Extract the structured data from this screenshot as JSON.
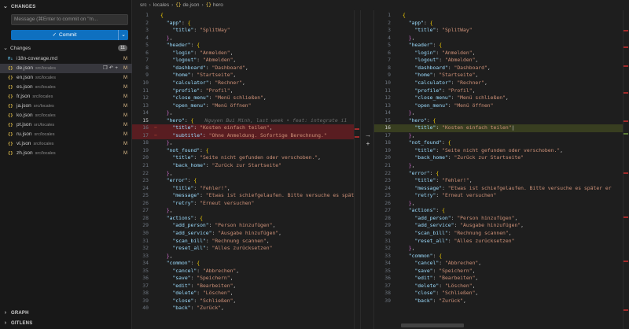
{
  "sidebar": {
    "changes_section": "CHANGES",
    "message_placeholder": "Message (⌘Enter to commit on \"m...",
    "commit_label": "Commit",
    "changes_group": "Changes",
    "changes_count": "11",
    "files": [
      {
        "icon": "md-file-icon",
        "icon_text": "M↓",
        "name": "i18n-coverage.md",
        "path": "",
        "status": "M"
      },
      {
        "icon": "json-file-icon",
        "icon_text": "{}",
        "name": "de.json",
        "path": "src/locales",
        "status": "M",
        "selected": true
      },
      {
        "icon": "json-file-icon",
        "icon_text": "{}",
        "name": "en.json",
        "path": "src/locales",
        "status": "M"
      },
      {
        "icon": "json-file-icon",
        "icon_text": "{}",
        "name": "es.json",
        "path": "src/locales",
        "status": "M"
      },
      {
        "icon": "json-file-icon",
        "icon_text": "{}",
        "name": "fr.json",
        "path": "src/locales",
        "status": "M"
      },
      {
        "icon": "json-file-icon",
        "icon_text": "{}",
        "name": "ja.json",
        "path": "src/locales",
        "status": "M"
      },
      {
        "icon": "json-file-icon",
        "icon_text": "{}",
        "name": "ko.json",
        "path": "src/locales",
        "status": "M"
      },
      {
        "icon": "json-file-icon",
        "icon_text": "{}",
        "name": "pt.json",
        "path": "src/locales",
        "status": "M"
      },
      {
        "icon": "json-file-icon",
        "icon_text": "{}",
        "name": "ru.json",
        "path": "src/locales",
        "status": "M"
      },
      {
        "icon": "json-file-icon",
        "icon_text": "{}",
        "name": "vi.json",
        "path": "src/locales",
        "status": "M"
      },
      {
        "icon": "json-file-icon",
        "icon_text": "{}",
        "name": "zh.json",
        "path": "src/locales",
        "status": "M"
      }
    ],
    "graph_section": "GRAPH",
    "gitlens_section": "GITLENS"
  },
  "breadcrumb": {
    "parts": [
      "src",
      "locales"
    ],
    "file": "de.json",
    "symbol": "hero"
  },
  "blame_text": "Nguyen Bui Minh, last week • feat: integrate i1",
  "left_lines": [
    {
      "n": "1",
      "t": "{"
    },
    {
      "n": "2",
      "t": "  \"app\": {"
    },
    {
      "n": "3",
      "t": "    \"title\": \"SplitWay\""
    },
    {
      "n": "4",
      "t": "  },"
    },
    {
      "n": "5",
      "t": "  \"header\": {"
    },
    {
      "n": "6",
      "t": "    \"login\": \"Anmelden\","
    },
    {
      "n": "7",
      "t": "    \"logout\": \"Abmelden\","
    },
    {
      "n": "8",
      "t": "    \"dashboard\": \"Dashboard\","
    },
    {
      "n": "9",
      "t": "    \"home\": \"Startseite\","
    },
    {
      "n": "10",
      "t": "    \"calculator\": \"Rechner\","
    },
    {
      "n": "11",
      "t": "    \"profile\": \"Profil\","
    },
    {
      "n": "12",
      "t": "    \"close_menu\": \"Menü schließen\","
    },
    {
      "n": "13",
      "t": "    \"open_menu\": \"Menü öffnen\""
    },
    {
      "n": "14",
      "t": "  },"
    },
    {
      "n": "15",
      "t": "  \"hero\": {"
    },
    {
      "n": "16",
      "t": "    \"title\": \"Kosten einfach teilen\","
    },
    {
      "n": "17",
      "t": "    \"subtitle\": \"Ohne Anmeldung. Sofortige Berechnung.\""
    },
    {
      "n": "18",
      "t": "  },"
    },
    {
      "n": "19",
      "t": "  \"not_found\": {"
    },
    {
      "n": "20",
      "t": "    \"title\": \"Seite nicht gefunden oder verschoben.\","
    },
    {
      "n": "21",
      "t": "    \"back_home\": \"Zurück zur Startseite\""
    },
    {
      "n": "22",
      "t": "  },"
    },
    {
      "n": "23",
      "t": "  \"error\": {"
    },
    {
      "n": "24",
      "t": "    \"title\": \"Fehler!\","
    },
    {
      "n": "25",
      "t": "    \"message\": \"Etwas ist schiefgelaufen. Bitte versuche es späte"
    },
    {
      "n": "26",
      "t": "    \"retry\": \"Erneut versuchen\""
    },
    {
      "n": "27",
      "t": "  },"
    },
    {
      "n": "28",
      "t": "  \"actions\": {"
    },
    {
      "n": "29",
      "t": "    \"add_person\": \"Person hinzufügen\","
    },
    {
      "n": "30",
      "t": "    \"add_service\": \"Ausgabe hinzufügen\","
    },
    {
      "n": "31",
      "t": "    \"scan_bill\": \"Rechnung scannen\","
    },
    {
      "n": "32",
      "t": "    \"reset_all\": \"Alles zurücksetzen\""
    },
    {
      "n": "33",
      "t": "  },"
    },
    {
      "n": "34",
      "t": "  \"common\": {"
    },
    {
      "n": "35",
      "t": "    \"cancel\": \"Abbrechen\","
    },
    {
      "n": "36",
      "t": "    \"save\": \"Speichern\","
    },
    {
      "n": "37",
      "t": "    \"edit\": \"Bearbeiten\","
    },
    {
      "n": "38",
      "t": "    \"delete\": \"Löschen\","
    },
    {
      "n": "39",
      "t": "    \"close\": \"Schließen\","
    },
    {
      "n": "40",
      "t": "    \"back\": \"Zurück\","
    }
  ],
  "right_lines": [
    {
      "n": "1",
      "t": "{"
    },
    {
      "n": "2",
      "t": "  \"app\": {"
    },
    {
      "n": "3",
      "t": "    \"title\": \"SplitWay\""
    },
    {
      "n": "4",
      "t": "  },"
    },
    {
      "n": "5",
      "t": "  \"header\": {"
    },
    {
      "n": "6",
      "t": "    \"login\": \"Anmelden\","
    },
    {
      "n": "7",
      "t": "    \"logout\": \"Abmelden\","
    },
    {
      "n": "8",
      "t": "    \"dashboard\": \"Dashboard\","
    },
    {
      "n": "9",
      "t": "    \"home\": \"Startseite\","
    },
    {
      "n": "10",
      "t": "    \"calculator\": \"Rechner\","
    },
    {
      "n": "11",
      "t": "    \"profile\": \"Profil\","
    },
    {
      "n": "12",
      "t": "    \"close_menu\": \"Menü schließen\","
    },
    {
      "n": "13",
      "t": "    \"open_menu\": \"Menü öffnen\""
    },
    {
      "n": "14",
      "t": "  },"
    },
    {
      "n": "15",
      "t": "  \"hero\": {"
    },
    {
      "n": "16",
      "t": "    \"title\": \"Kosten einfach teilen\""
    },
    {
      "n": "17",
      "t": "  },"
    },
    {
      "n": "18",
      "t": "  \"not_found\": {"
    },
    {
      "n": "19",
      "t": "    \"title\": \"Seite nicht gefunden oder verschoben.\","
    },
    {
      "n": "20",
      "t": "    \"back_home\": \"Zurück zur Startseite\""
    },
    {
      "n": "21",
      "t": "  },"
    },
    {
      "n": "22",
      "t": "  \"error\": {"
    },
    {
      "n": "23",
      "t": "    \"title\": \"Fehler!\","
    },
    {
      "n": "24",
      "t": "    \"message\": \"Etwas ist schiefgelaufen. Bitte versuche es später er"
    },
    {
      "n": "25",
      "t": "    \"retry\": \"Erneut versuchen\""
    },
    {
      "n": "26",
      "t": "  },"
    },
    {
      "n": "27",
      "t": "  \"actions\": {"
    },
    {
      "n": "28",
      "t": "    \"add_person\": \"Person hinzufügen\","
    },
    {
      "n": "29",
      "t": "    \"add_service\": \"Ausgabe hinzufügen\","
    },
    {
      "n": "30",
      "t": "    \"scan_bill\": \"Rechnung scannen\","
    },
    {
      "n": "31",
      "t": "    \"reset_all\": \"Alles zurücksetzen\""
    },
    {
      "n": "32",
      "t": "  },"
    },
    {
      "n": "33",
      "t": "  \"common\": {"
    },
    {
      "n": "34",
      "t": "    \"cancel\": \"Abbrechen\","
    },
    {
      "n": "35",
      "t": "    \"save\": \"Speichern\","
    },
    {
      "n": "36",
      "t": "    \"edit\": \"Bearbeiten\","
    },
    {
      "n": "37",
      "t": "    \"delete\": \"Löschen\","
    },
    {
      "n": "38",
      "t": "    \"close\": \"Schließen\","
    },
    {
      "n": "39",
      "t": "    \"back\": \"Zurück\","
    }
  ],
  "diff": {
    "left_deleted": [
      "17"
    ],
    "left_modified": [
      "16"
    ],
    "right_inserted": [
      "16"
    ],
    "current_line": "16",
    "blame_line": "15"
  },
  "colors": {
    "accent": "#0e70c0",
    "deleted": "#a12b2b",
    "inserted": "#5e7d3a",
    "modified_status": "#e2c08d"
  }
}
